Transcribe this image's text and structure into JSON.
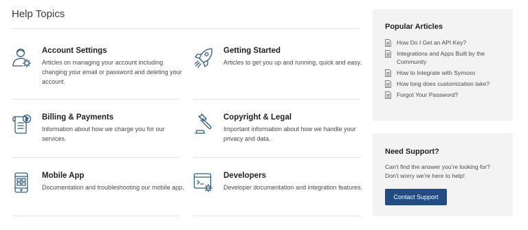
{
  "page": {
    "title": "Help Topics"
  },
  "topics": [
    {
      "title": "Account Settings",
      "description": "Articles on managing your account including changing your email or password and deleting your account.",
      "icon": "user-settings-icon"
    },
    {
      "title": "Getting Started",
      "description": "Articles to get you up and running, quick and easy.",
      "icon": "rocket-icon"
    },
    {
      "title": "Billing & Payments",
      "description": "Information about how we charge you for our services.",
      "icon": "billing-receipt-icon"
    },
    {
      "title": "Copyright & Legal",
      "description": "Important information about how we handle your privacy and data.",
      "icon": "gavel-icon"
    },
    {
      "title": "Mobile App",
      "description": "Documentation and troubleshooting our mobile app.",
      "icon": "mobile-app-icon"
    },
    {
      "title": "Developers",
      "description": "Developer documentation and integration features.",
      "icon": "developer-code-icon"
    }
  ],
  "popular_articles": {
    "title": "Popular Articles",
    "items": [
      {
        "label": "How Do I Get an API Key?"
      },
      {
        "label": "Integrations and Apps Built by the Community"
      },
      {
        "label": "How to Integrate with Symoxo"
      },
      {
        "label": "How long does customization take?"
      },
      {
        "label": "Forgot Your Password?"
      }
    ]
  },
  "support": {
    "title": "Need Support?",
    "text": "Can't find the answer you're looking for? Don't worry we're here to help!",
    "button_label": "Contact Support"
  },
  "colors": {
    "accent": "#214d83",
    "icon": "#2e5a88",
    "sidebar_bg": "#f3f3f3",
    "divider": "#e4e4e4"
  }
}
